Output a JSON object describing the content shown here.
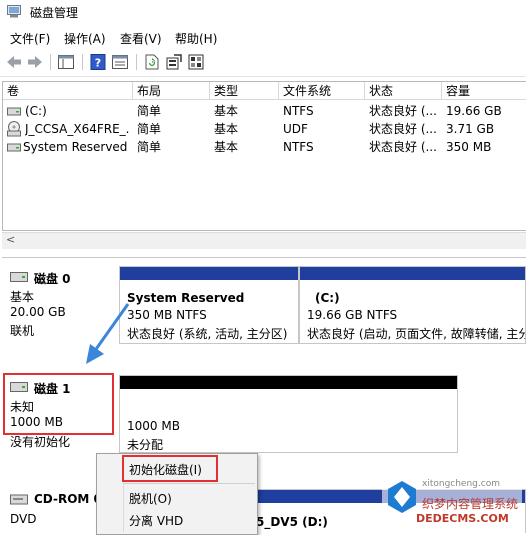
{
  "window": {
    "title": "磁盘管理"
  },
  "menu": {
    "items": [
      "文件(F)",
      "操作(A)",
      "查看(V)",
      "帮助(H)"
    ]
  },
  "toolbar": {
    "icons": [
      "back-icon",
      "forward-icon",
      "console-tree-icon",
      "help-icon",
      "properties-icon",
      "refresh-icon",
      "export-icon",
      "settings-icon"
    ]
  },
  "table": {
    "columns": [
      "卷",
      "布局",
      "类型",
      "文件系统",
      "状态",
      "容量"
    ],
    "rows": [
      {
        "volume": "(C:)",
        "layout": "简单",
        "type": "基本",
        "fs": "NTFS",
        "status": "状态良好 (...",
        "capacity": "19.66 GB"
      },
      {
        "volume": "J_CCSA_X64FRE_...",
        "layout": "简单",
        "type": "基本",
        "fs": "UDF",
        "status": "状态良好 (...",
        "capacity": "3.71 GB"
      },
      {
        "volume": "System Reserved",
        "layout": "简单",
        "type": "基本",
        "fs": "NTFS",
        "status": "状态良好 (...",
        "capacity": "350 MB"
      }
    ],
    "scroll_left_glyph": "<"
  },
  "disk0": {
    "name": "磁盘 0",
    "type": "基本",
    "size": "20.00 GB",
    "state": "联机",
    "partitions": [
      {
        "name": "System Reserved",
        "detail": "350 MB NTFS",
        "status": "状态良好 (系统, 活动, 主分区)"
      },
      {
        "name": "(C:)",
        "detail": "19.66 GB NTFS",
        "status": "状态良好 (启动, 页面文件, 故障转储, 主分"
      }
    ]
  },
  "disk1": {
    "name": "磁盘 1",
    "type": "未知",
    "size": "1000 MB",
    "state": "没有初始化",
    "partition": {
      "size": "1000 MB",
      "status": "未分配"
    }
  },
  "cdrom": {
    "name": "CD-ROM 0",
    "type": "DVD",
    "label": "5_DV5  (D:)"
  },
  "context_menu": {
    "items": [
      "初始化磁盘(I)",
      "脱机(O)",
      "分离 VHD"
    ]
  },
  "watermark": {
    "line1": "织梦内容管理系统",
    "line2": "DEDECMS.COM",
    "line3": "xitongcheng.com"
  },
  "colors": {
    "accent_red": "#e03030",
    "arrow_blue": "#3a86d8",
    "partition_blue": "#1f3e9d"
  }
}
